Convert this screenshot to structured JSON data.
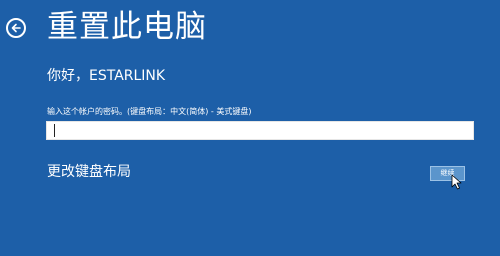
{
  "header": {
    "title": "重置此电脑",
    "back_icon": "back-arrow-circle-icon"
  },
  "greeting": "你好，ESTARLINK",
  "password": {
    "label": "输入这个帐户的密码。(键盘布局：中文(简体) - 美式键盘)",
    "value": ""
  },
  "change_layout_label": "更改键盘布局",
  "next_button_label": "继续",
  "icons": {
    "cursor": "mouse-cursor-icon"
  },
  "colors": {
    "background": "#1d5fa8",
    "text": "#ffffff",
    "button": "#5b95cc"
  }
}
